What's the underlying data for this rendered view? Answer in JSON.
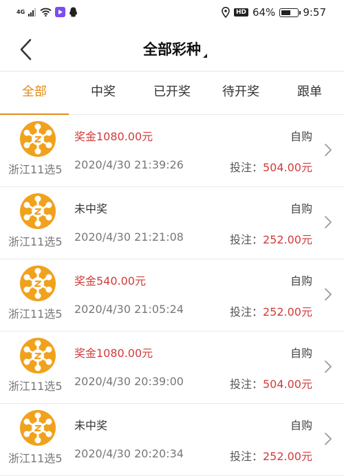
{
  "status_bar": {
    "network": "4G",
    "battery": "64%",
    "battery_level": 0.64,
    "time": "9:57",
    "hd": "HD"
  },
  "header": {
    "title": "全部彩种"
  },
  "tabs": [
    {
      "label": "全部",
      "active": true
    },
    {
      "label": "中奖",
      "active": false
    },
    {
      "label": "已开奖",
      "active": false
    },
    {
      "label": "待开奖",
      "active": false
    },
    {
      "label": "跟单",
      "active": false
    }
  ],
  "records": [
    {
      "lottery": "浙江11选5",
      "prize": "奖金1080.00元",
      "won": true,
      "datetime": "2020/4/30 21:39:26",
      "type": "自购",
      "bet_label": "投注：",
      "bet_amount": "504.00元"
    },
    {
      "lottery": "浙江11选5",
      "prize": "未中奖",
      "won": false,
      "datetime": "2020/4/30 21:21:08",
      "type": "自购",
      "bet_label": "投注：",
      "bet_amount": "252.00元"
    },
    {
      "lottery": "浙江11选5",
      "prize": "奖金540.00元",
      "won": true,
      "datetime": "2020/4/30 21:05:24",
      "type": "自购",
      "bet_label": "投注：",
      "bet_amount": "252.00元"
    },
    {
      "lottery": "浙江11选5",
      "prize": "奖金1080.00元",
      "won": true,
      "datetime": "2020/4/30 20:39:00",
      "type": "自购",
      "bet_label": "投注：",
      "bet_amount": "504.00元"
    },
    {
      "lottery": "浙江11选5",
      "prize": "未中奖",
      "won": false,
      "datetime": "2020/4/30 20:20:34",
      "type": "自购",
      "bet_label": "投注：",
      "bet_amount": "252.00元"
    }
  ],
  "colors": {
    "accent": "#e48a18",
    "prize_red": "#d23a3a",
    "logo_gold": "#f0a21c"
  },
  "icons": {
    "back": "chevron-left-icon",
    "row_arrow": "chevron-right-icon",
    "lottery_logo": "lottery-logo-icon"
  }
}
